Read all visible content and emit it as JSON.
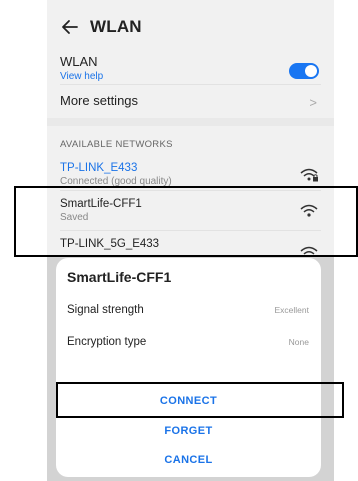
{
  "header": {
    "title": "WLAN",
    "back_icon": "back-arrow-icon"
  },
  "wlan": {
    "label": "WLAN",
    "help_link": "View help",
    "enabled": true,
    "accent": "#1976f2"
  },
  "more_settings": {
    "label": "More settings",
    "chevron": ">"
  },
  "available": {
    "section_title": "AVAILABLE NETWORKS",
    "networks": [
      {
        "name": "TP-LINK_E433",
        "status": "Connected (good quality)",
        "connected": true,
        "locked": true
      },
      {
        "name": "SmartLife-CFF1",
        "status": "Saved",
        "connected": false,
        "locked": false
      },
      {
        "name": "TP-LINK_5G_E433",
        "status": "",
        "connected": false,
        "locked": true
      }
    ]
  },
  "dialog": {
    "title": "SmartLife-CFF1",
    "signal_label": "Signal strength",
    "signal_value": "Excellent",
    "encryption_label": "Encryption type",
    "encryption_value": "None",
    "connect_label": "CONNECT",
    "forget_label": "FORGET",
    "cancel_label": "CANCEL"
  }
}
